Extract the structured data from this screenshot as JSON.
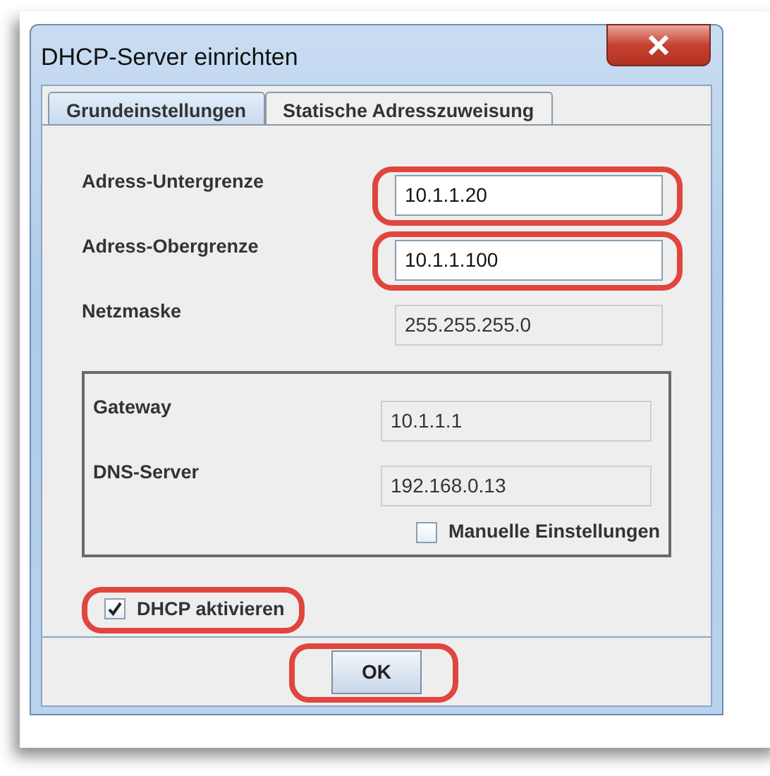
{
  "window": {
    "title": "DHCP-Server einrichten"
  },
  "tabs": [
    {
      "label": "Grundeinstellungen",
      "selected": true
    },
    {
      "label": "Statische Adresszuweisung",
      "selected": false
    }
  ],
  "fields": [
    {
      "label": "Adress-Untergrenze",
      "value": "10.1.1.20",
      "disabled": false,
      "highlighted": true
    },
    {
      "label": "Adress-Obergrenze",
      "value": "10.1.1.100",
      "disabled": false,
      "highlighted": true
    },
    {
      "label": "Netzmaske",
      "value": "255.255.255.0",
      "disabled": true,
      "highlighted": false
    }
  ],
  "group": {
    "fields": [
      {
        "label": "Gateway",
        "value": "10.1.1.1",
        "disabled": true
      },
      {
        "label": "DNS-Server",
        "value": "192.168.0.13",
        "disabled": true
      }
    ],
    "checkbox": {
      "label": "Manuelle Einstellungen",
      "checked": false
    }
  },
  "dhcp_checkbox": {
    "label": "DHCP aktivieren",
    "checked": true,
    "highlighted": true
  },
  "ok_button": {
    "label": "OK",
    "highlighted": true
  }
}
